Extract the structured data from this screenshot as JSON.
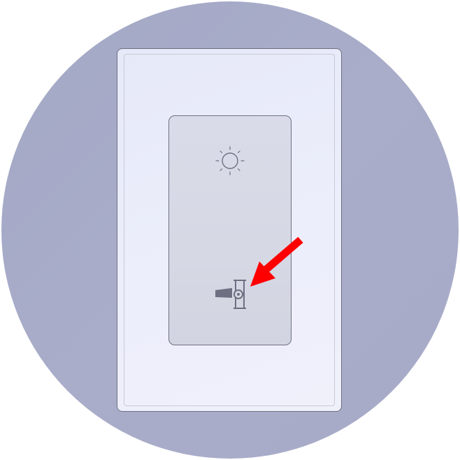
{
  "scene": {
    "title": "",
    "background_color": "#a7abc8",
    "plate_color": "#eaecfa",
    "rocker_color": "#d6d8e4",
    "outline_color": "#6e7082",
    "icon_color": "#6e7082",
    "arrow_color": "#ff0000"
  },
  "icons": {
    "top": "sun-icon",
    "bottom": "switch-toggle-icon",
    "pointer": "red-arrow"
  }
}
